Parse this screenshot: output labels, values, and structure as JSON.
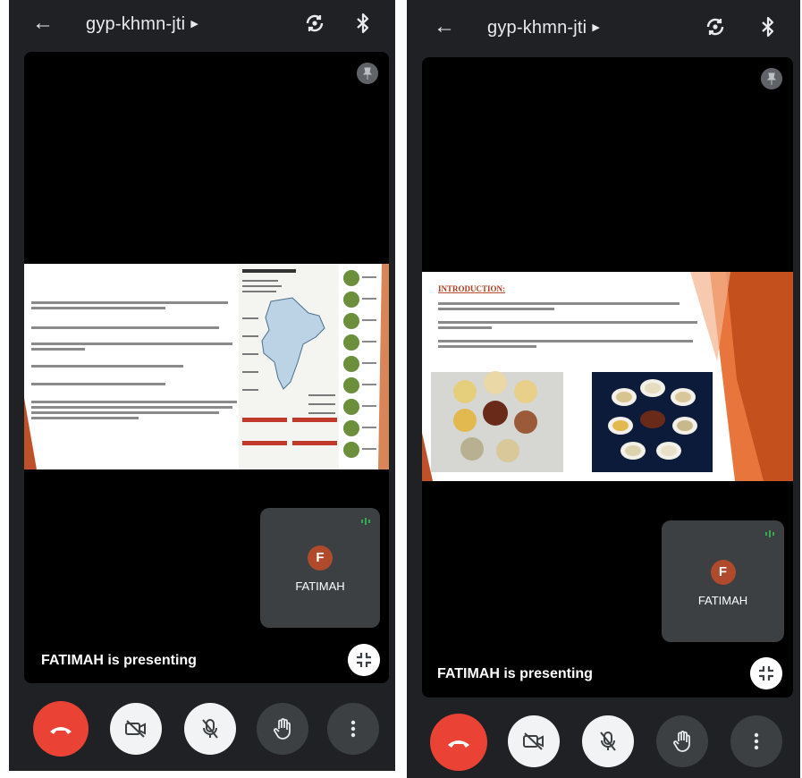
{
  "screens": [
    {
      "meeting_code": "gyp-khmn-jti",
      "participant_initial": "F",
      "participant_name": "FATIMAH",
      "presenting_text": "FATIMAH is presenting"
    },
    {
      "meeting_code": "gyp-khmn-jti",
      "participant_initial": "F",
      "participant_name": "FATIMAH",
      "presenting_text": "FATIMAH is presenting",
      "slide_heading": "INTRODUCTION:"
    }
  ],
  "icons": {
    "back": "back-arrow-icon",
    "switch_camera": "switch-camera-icon",
    "bluetooth": "bluetooth-icon",
    "pin": "pin-icon",
    "speaking": "speaking-icon",
    "fullscreen": "fullscreen-icon",
    "end_call": "end-call-icon",
    "camera_off": "camera-off-icon",
    "mic_off": "mic-off-icon",
    "raise_hand": "raise-hand-icon",
    "more": "more-options-icon"
  },
  "colors": {
    "background": "#202124",
    "stage": "#000000",
    "tile": "#3c4043",
    "end_call": "#ea4335",
    "avatar": "#b04a2c",
    "speaking": "#34a853"
  }
}
